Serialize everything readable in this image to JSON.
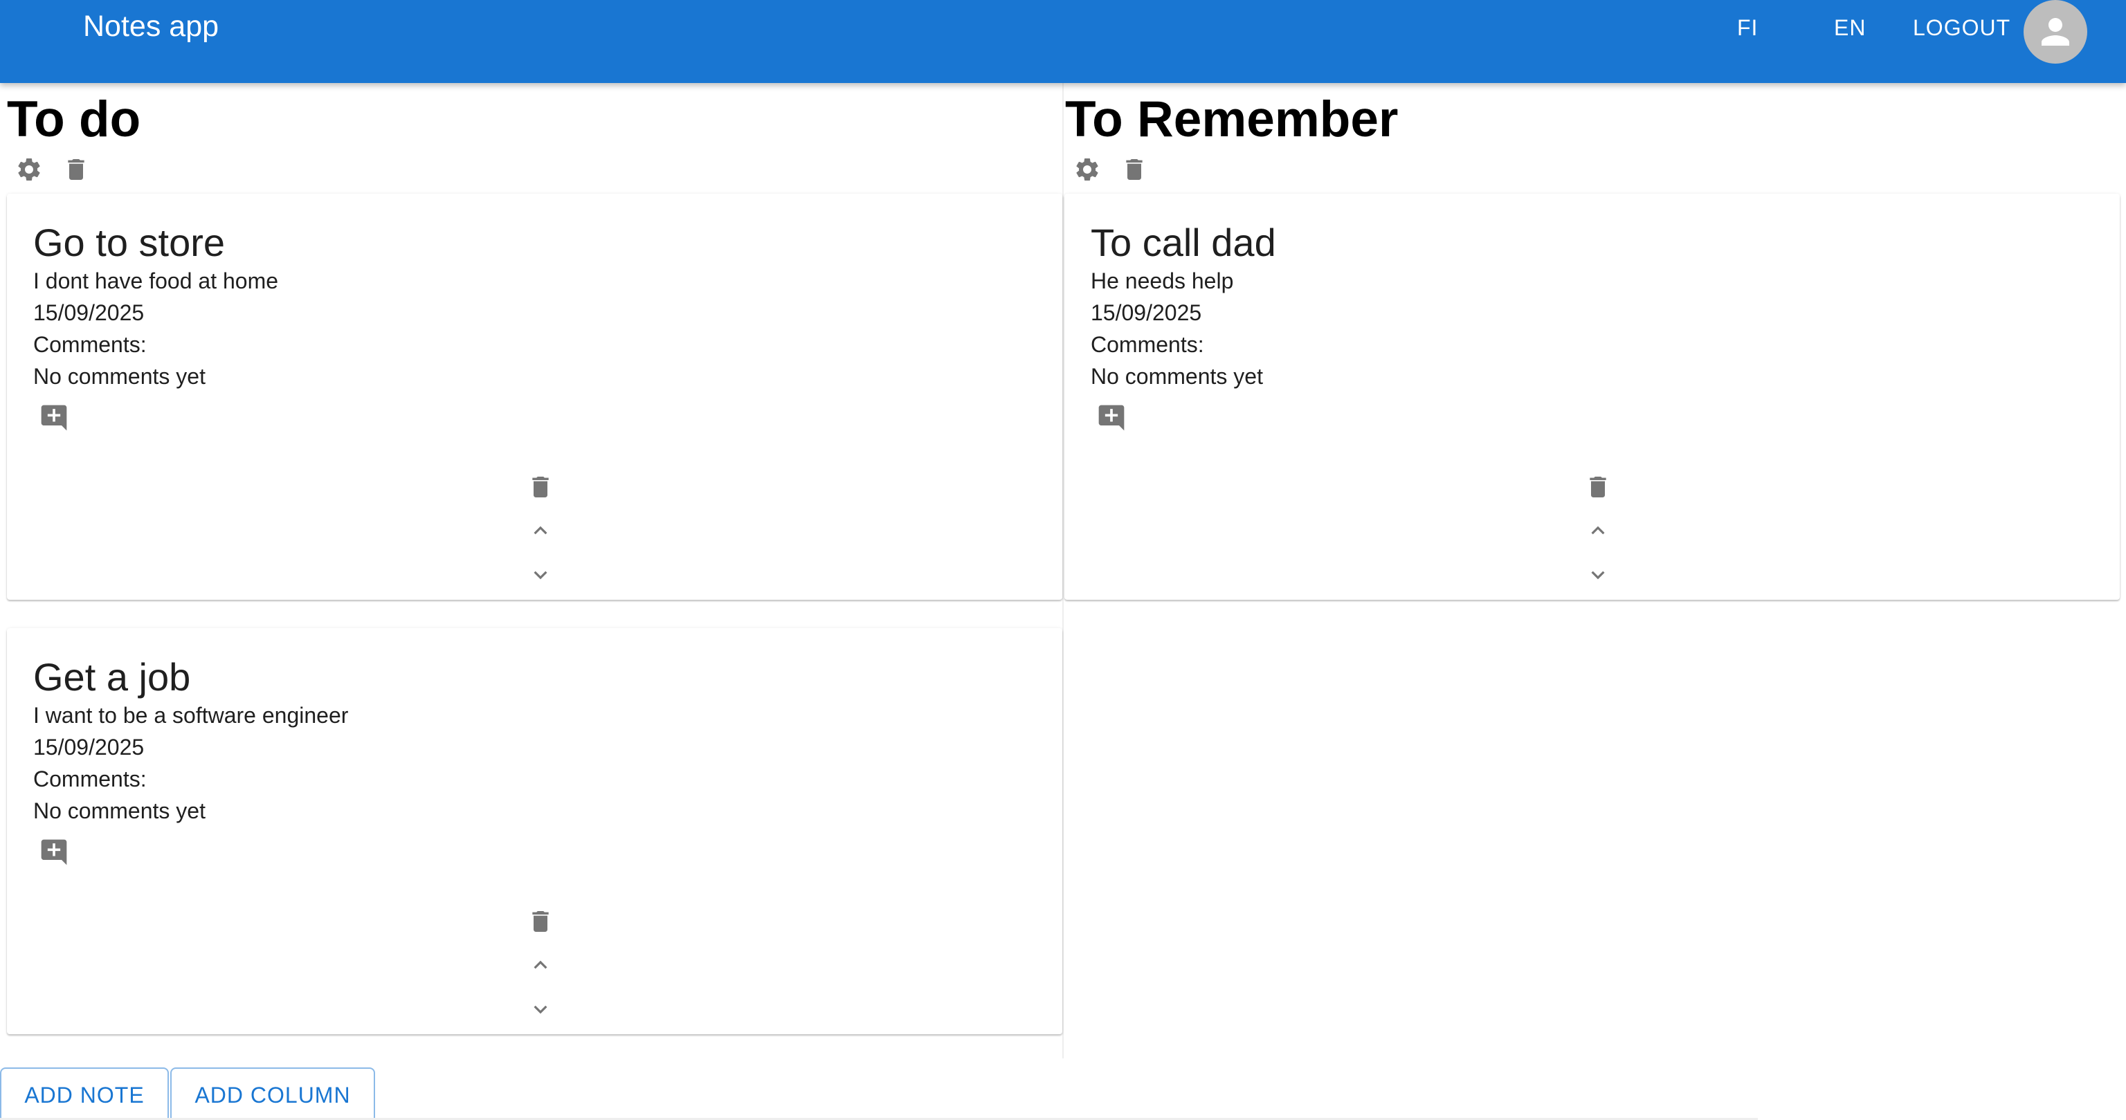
{
  "app": {
    "title": "Notes app"
  },
  "nav": {
    "fi_label": "FI",
    "en_label": "EN",
    "logout_label": "LOGOUT"
  },
  "columns": [
    {
      "title": "To do",
      "notes": [
        {
          "title": "Go to store",
          "body": "I dont have food at home",
          "date": "15/09/2025",
          "comments_label": "Comments:",
          "comments_text": "No comments yet"
        },
        {
          "title": "Get a job",
          "body": "I want to be a software engineer",
          "date": "15/09/2025",
          "comments_label": "Comments:",
          "comments_text": "No comments yet"
        }
      ]
    },
    {
      "title": "To Remember",
      "notes": [
        {
          "title": "To call dad",
          "body": "He needs help",
          "date": "15/09/2025",
          "comments_label": "Comments:",
          "comments_text": "No comments yet"
        }
      ]
    }
  ],
  "actions": {
    "add_note_label": "ADD NOTE",
    "add_column_label": "ADD COLUMN"
  },
  "colors": {
    "appbar": "#1976d2",
    "icon": "#757575",
    "button_text": "#1976d2"
  },
  "icons": {
    "column_actions": [
      "gear-icon",
      "trash-icon"
    ],
    "note_actions": [
      "add-comment-icon",
      "trash-icon",
      "chevron-up-icon",
      "chevron-down-icon"
    ],
    "header": [
      "user-avatar-icon"
    ]
  }
}
